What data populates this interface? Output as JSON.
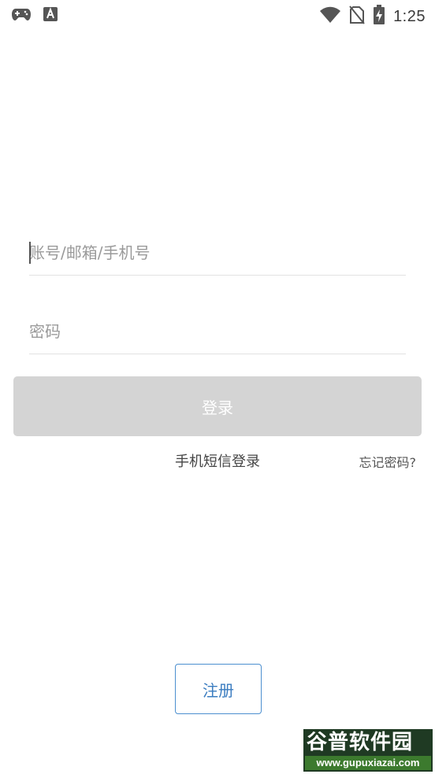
{
  "status_bar": {
    "time": "1:25",
    "left_icons": [
      "gamepad-icon",
      "font-a-icon"
    ],
    "right_icons": [
      "wifi-icon",
      "no-sim-icon",
      "battery-charging-icon"
    ]
  },
  "form": {
    "account_placeholder": "账号/邮箱/手机号",
    "password_placeholder": "密码",
    "login_label": "登录",
    "sms_login_label": "手机短信登录",
    "forgot_label": "忘记密码?",
    "register_label": "注册"
  },
  "colors": {
    "login_button_bg": "#d4d4d4",
    "register_border": "#4c8fcf",
    "divider": "#e2e2e2"
  },
  "watermark": {
    "title": "谷普软件园",
    "url": "www.gupuxiazai.com"
  }
}
